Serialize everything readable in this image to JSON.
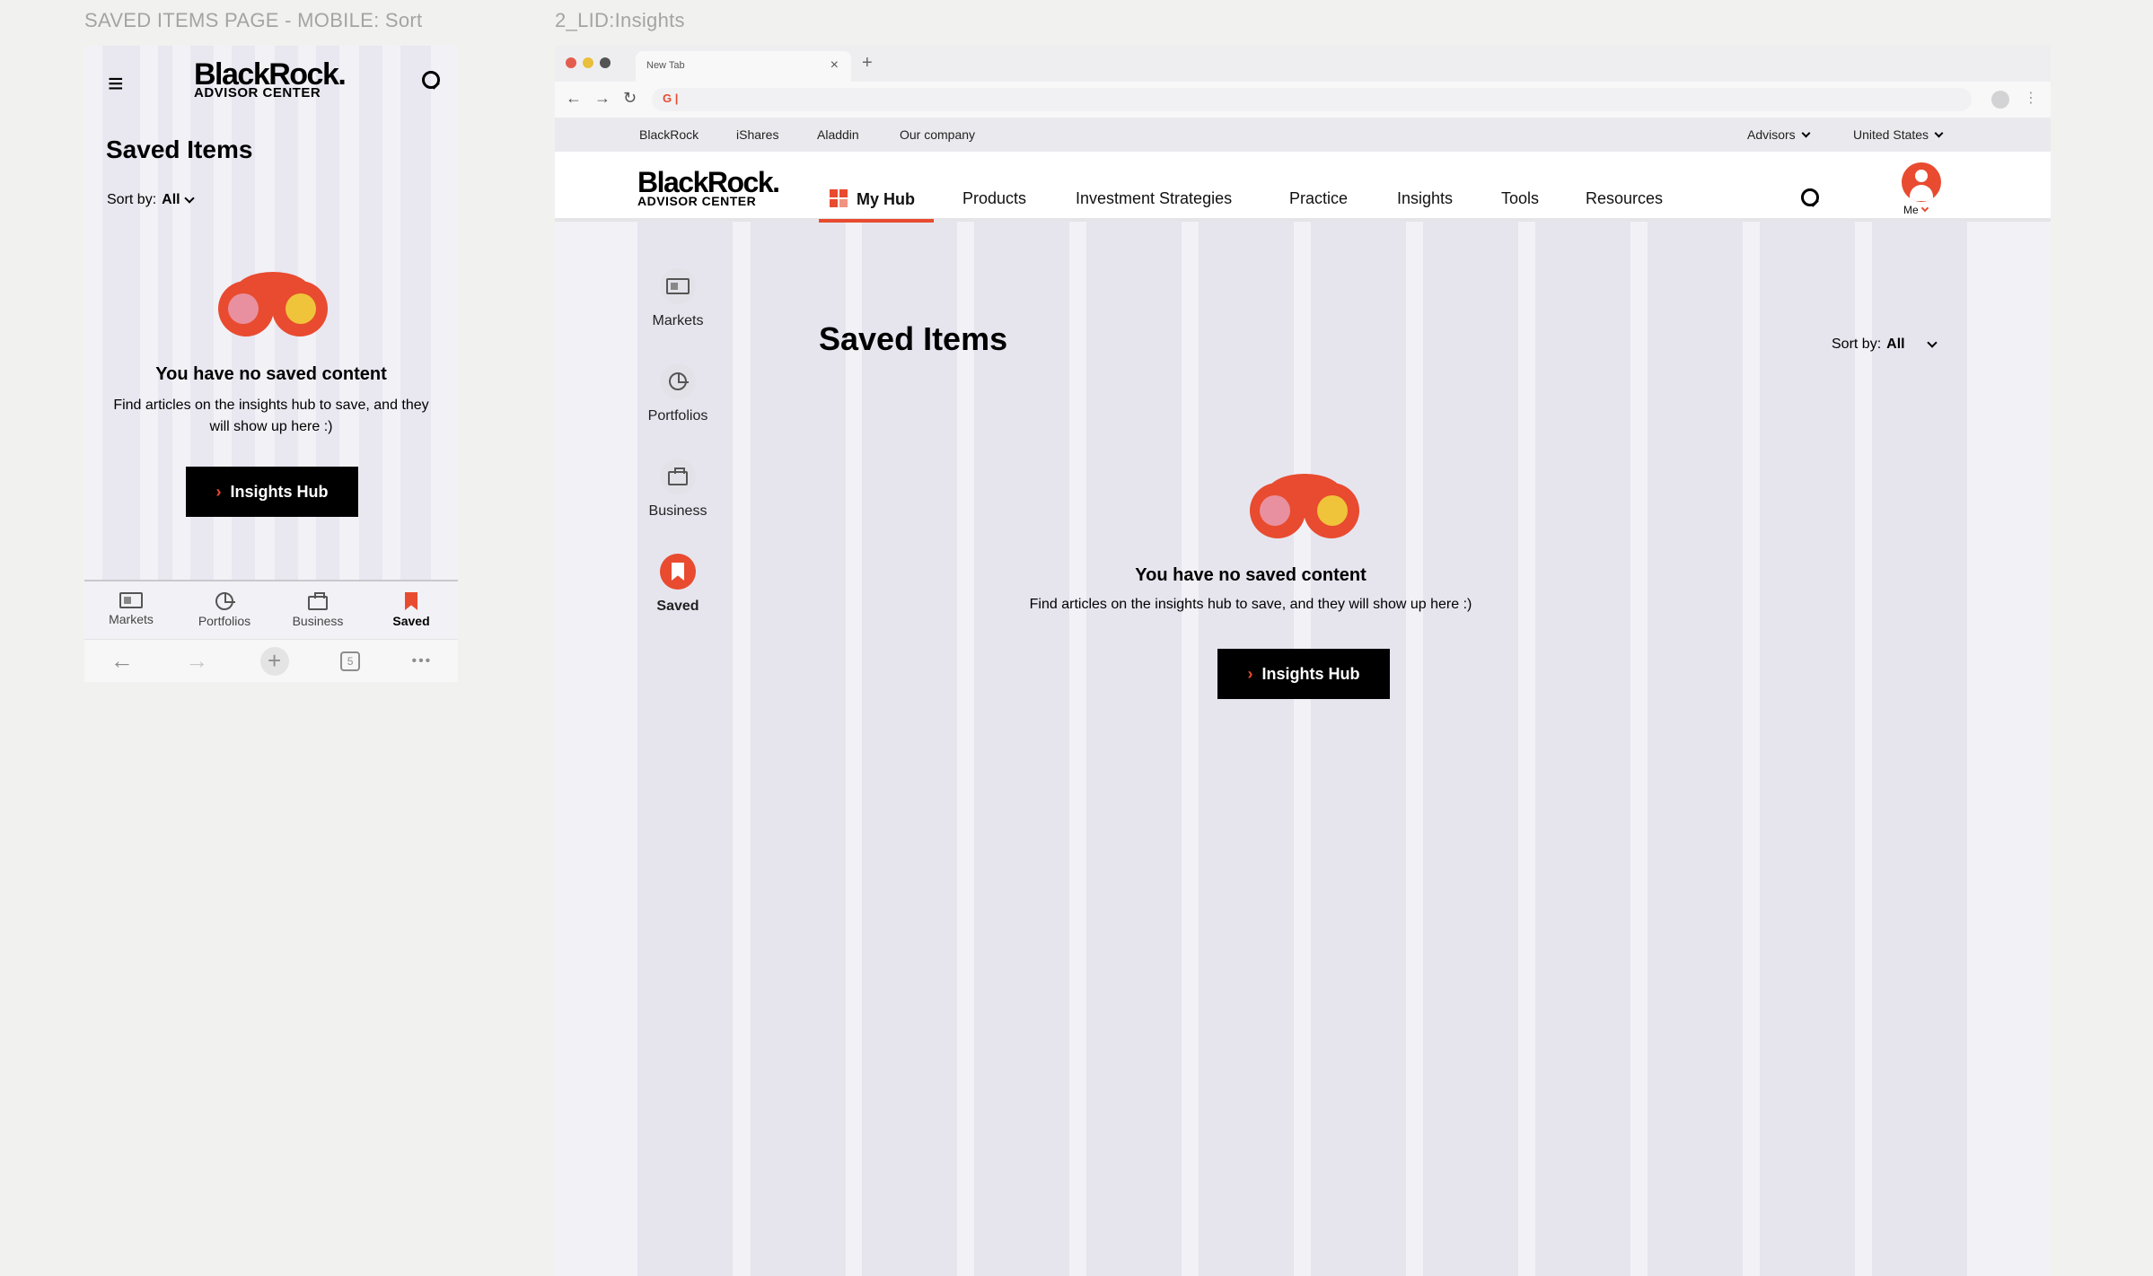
{
  "frames": {
    "mobile_label": "SAVED ITEMS PAGE - MOBILE: Sort",
    "desktop_label": "2_LID:Insights"
  },
  "brand": {
    "name": "BlackRock.",
    "sub": "ADVISOR CENTER",
    "accent": "#e84b2f",
    "lens_pink": "#e8909f",
    "lens_yellow": "#f0c43a"
  },
  "mobile": {
    "menu_icon": "hamburger-icon",
    "search_icon": "search-icon",
    "title": "Saved Items",
    "sort_label": "Sort by:",
    "sort_value": "All",
    "empty_title": "You have no saved content",
    "empty_text": "Find articles on the insights hub to save, and they will show up here :)",
    "cta_label": "Insights Hub",
    "tabs": [
      {
        "label": "Markets",
        "icon": "newspaper-icon"
      },
      {
        "label": "Portfolios",
        "icon": "pie-chart-icon"
      },
      {
        "label": "Business",
        "icon": "briefcase-icon"
      },
      {
        "label": "Saved",
        "icon": "bookmark-icon",
        "active": true
      }
    ],
    "browser_bar": {
      "back": "←",
      "forward": "→",
      "new_tab": "+",
      "tab_count": "5",
      "more": "•••"
    }
  },
  "desktop": {
    "browser": {
      "tab_title": "New Tab",
      "tab_close": "×",
      "new_tab": "+",
      "omnibox_value": "G |"
    },
    "utility_nav": {
      "links": [
        "BlackRock",
        "iShares",
        "Aladdin",
        "Our company"
      ],
      "audience": "Advisors",
      "region": "United States"
    },
    "main_nav": {
      "items": [
        "My Hub",
        "Products",
        "Investment Strategies",
        "Practice",
        "Insights",
        "Tools",
        "Resources"
      ],
      "active": "My Hub",
      "account_label": "Me"
    },
    "sidebar": [
      {
        "label": "Markets",
        "icon": "newspaper-icon"
      },
      {
        "label": "Portfolios",
        "icon": "pie-chart-icon"
      },
      {
        "label": "Business",
        "icon": "briefcase-icon"
      },
      {
        "label": "Saved",
        "icon": "bookmark-icon",
        "active": true
      }
    ],
    "title": "Saved Items",
    "sort_label": "Sort by:",
    "sort_value": "All",
    "empty_title": "You have no saved content",
    "empty_text": "Find articles on the insights hub to save, and they will show up here :)",
    "cta_label": "Insights Hub"
  }
}
